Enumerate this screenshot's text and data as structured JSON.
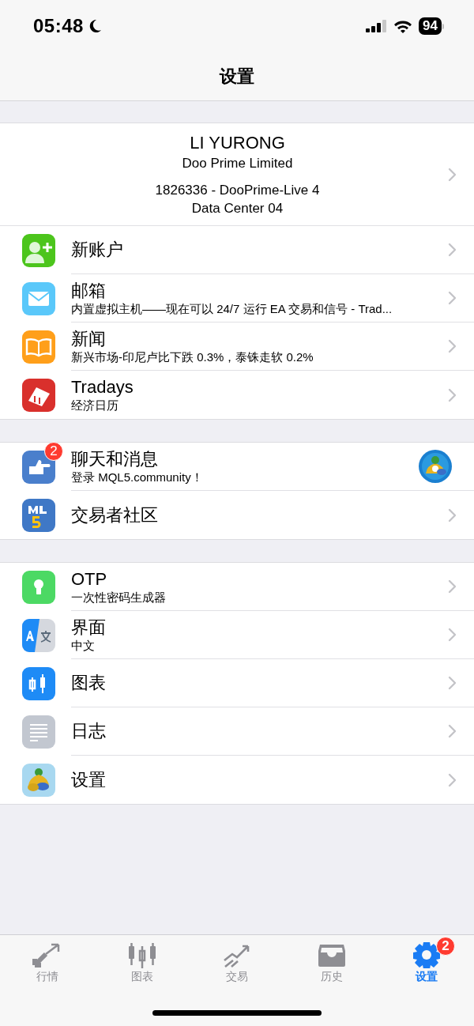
{
  "status_bar": {
    "time": "05:48",
    "battery": "94"
  },
  "nav": {
    "title": "设置"
  },
  "account": {
    "name": "LI YURONG",
    "company": "Doo Prime Limited",
    "server": "1826336 - DooPrime-Live 4",
    "data_center": "Data Center 04"
  },
  "sections": [
    {
      "items": [
        {
          "kind": "link",
          "title": "新账户"
        },
        {
          "kind": "link",
          "title": "邮箱",
          "subtitle": "内置虚拟主机——现在可以 24/7 运行 EA 交易和信号 - Trad..."
        },
        {
          "kind": "link",
          "title": "新闻",
          "subtitle": "新兴市场-印尼卢比下跌 0.3%，泰铢走软 0.2%"
        },
        {
          "kind": "link",
          "title": "Tradays",
          "subtitle": "经济日历"
        }
      ]
    },
    {
      "items": [
        {
          "kind": "chat",
          "title": "聊天和消息",
          "subtitle": "登录 MQL5.community！",
          "badge": "2"
        },
        {
          "kind": "link",
          "title": "交易者社区"
        }
      ]
    },
    {
      "items": [
        {
          "kind": "link",
          "title": "OTP",
          "subtitle": "一次性密码生成器"
        },
        {
          "kind": "link",
          "title": "界面",
          "subtitle": "中文"
        },
        {
          "kind": "link",
          "title": "图表"
        },
        {
          "kind": "link",
          "title": "日志"
        },
        {
          "kind": "link",
          "title": "设置"
        }
      ]
    }
  ],
  "tab_bar": [
    {
      "label": "行情",
      "selected": false
    },
    {
      "label": "图表",
      "selected": false
    },
    {
      "label": "交易",
      "selected": false
    },
    {
      "label": "历史",
      "selected": false
    },
    {
      "label": "设置",
      "selected": true,
      "badge": "2"
    }
  ]
}
